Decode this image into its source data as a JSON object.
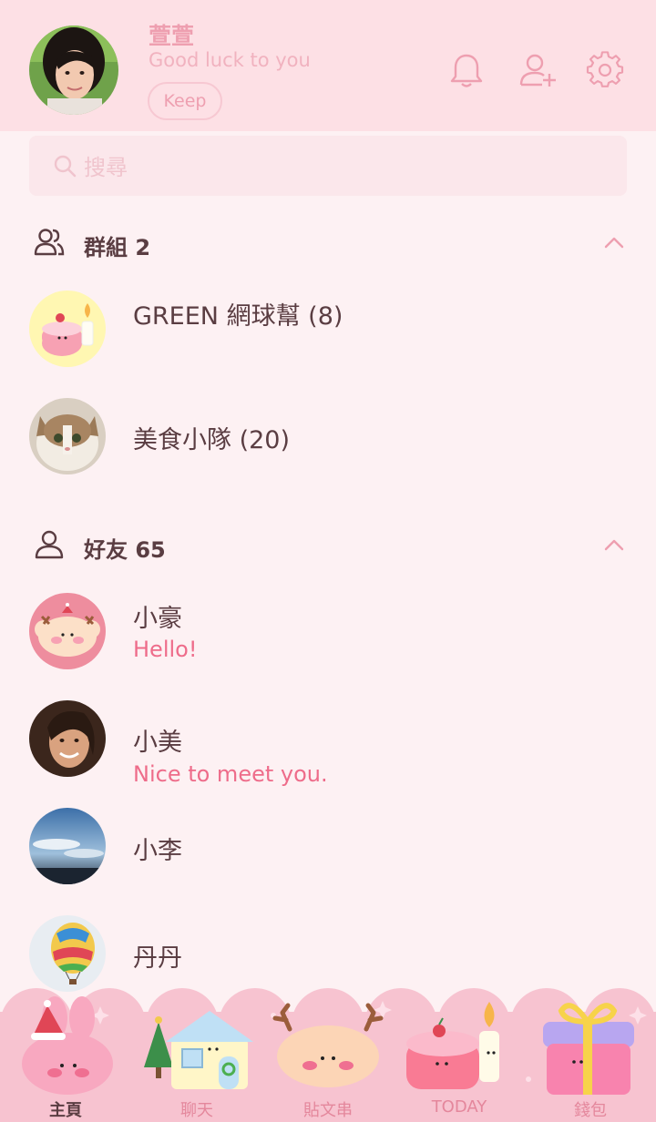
{
  "profile": {
    "name": "萱萱",
    "status": "Good luck to you",
    "keep_label": "Keep"
  },
  "search": {
    "placeholder": "搜尋"
  },
  "groups": {
    "title": "群組 2",
    "items": [
      {
        "name": "GREEN 網球幫 (8)"
      },
      {
        "name": "美食小隊 (20)"
      }
    ]
  },
  "friends": {
    "title": "好友 65",
    "items": [
      {
        "name": "小豪",
        "message": "Hello!"
      },
      {
        "name": "小美",
        "message": "Nice to meet you."
      },
      {
        "name": "小李"
      },
      {
        "name": "丹丹"
      }
    ]
  },
  "nav": {
    "home": "主頁",
    "chat": "聊天",
    "timeline": "貼文串",
    "today": "TODAY",
    "wallet": "錢包"
  },
  "colors": {
    "header_bg": "#fde0e5",
    "page_bg": "#fdf1f3",
    "accent": "#ee9fb0",
    "message": "#ee6c8a",
    "nav_bg": "#f7c3d0"
  },
  "icons": {
    "header": [
      "bell-icon",
      "add-friend-icon",
      "settings-gear-icon"
    ],
    "section": [
      "group-icon",
      "person-icon",
      "chevron-up-icon"
    ],
    "search": "search-icon"
  }
}
